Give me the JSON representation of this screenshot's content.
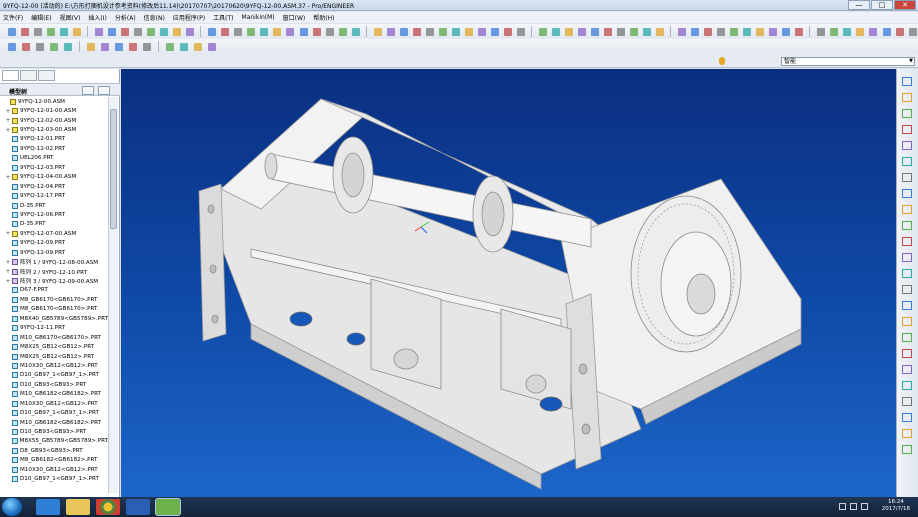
{
  "window": {
    "title": "9YFQ-12-00 (活动的) E:\\方形打捆机设计参考资料(修改后11.14)\\20170707\\20170620\\9YFQ-12-00.ASM.37 - Pro/ENGINEER",
    "controls": [
      "—",
      "□",
      "✕"
    ]
  },
  "menu": [
    "文件(F)",
    "编辑(E)",
    "视图(V)",
    "插入(I)",
    "分析(A)",
    "信息(N)",
    "应用程序(P)",
    "工具(T)",
    "Manikin(M)",
    "窗口(W)",
    "帮助(H)"
  ],
  "filter": {
    "value": "智能"
  },
  "panel": {
    "header": "模型树",
    "tree": [
      {
        "label": "9YFQ-12-00.ASM",
        "kind": "asm",
        "exp": ""
      },
      {
        "label": "9YFQ-12-01-00.ASM",
        "kind": "asm",
        "exp": "+"
      },
      {
        "label": "9YFQ-12-02-00.ASM",
        "kind": "asm",
        "exp": "+"
      },
      {
        "label": "9YFQ-12-03-00.ASM",
        "kind": "asm",
        "exp": "+"
      },
      {
        "label": "9YFQ-12-01.PRT",
        "kind": "prt",
        "exp": ""
      },
      {
        "label": "9YFQ-12-02.PRT",
        "kind": "prt",
        "exp": ""
      },
      {
        "label": "UEL206.PRT",
        "kind": "prt",
        "exp": ""
      },
      {
        "label": "9YFQ-12-03.PRT",
        "kind": "prt",
        "exp": ""
      },
      {
        "label": "9YFQ-12-04-00.ASM",
        "kind": "asm",
        "exp": "+"
      },
      {
        "label": "9YFQ-12-04.PRT",
        "kind": "prt",
        "exp": ""
      },
      {
        "label": "9YFQ-12-17.PRT",
        "kind": "prt",
        "exp": ""
      },
      {
        "label": "D-35.PRT",
        "kind": "prt",
        "exp": ""
      },
      {
        "label": "9YFQ-12-06.PRT",
        "kind": "prt",
        "exp": ""
      },
      {
        "label": "D-35.PRT",
        "kind": "prt",
        "exp": ""
      },
      {
        "label": "9YFQ-12-07-00.ASM",
        "kind": "asm",
        "exp": "+"
      },
      {
        "label": "9YFQ-12-09.PRT",
        "kind": "prt",
        "exp": ""
      },
      {
        "label": "9YFQ-12-09.PRT",
        "kind": "prt",
        "exp": ""
      },
      {
        "label": "阵列 1 / 9YFQ-12-08-00.ASM",
        "kind": "pat",
        "exp": "+"
      },
      {
        "label": "阵列 2 / 9YFQ-12-10.PRT",
        "kind": "pat",
        "exp": "+"
      },
      {
        "label": "阵列 3 / 9YFQ-12-09-00.ASM",
        "kind": "pat",
        "exp": "+"
      },
      {
        "label": "D67-F.PRT",
        "kind": "prt",
        "exp": ""
      },
      {
        "label": "M8_GB6170<GB6170>.PRT",
        "kind": "prt",
        "exp": ""
      },
      {
        "label": "M8_GB6170<GB6170>.PRT",
        "kind": "prt",
        "exp": ""
      },
      {
        "label": "M8X40_GB5789<GB5789>.PRT",
        "kind": "prt",
        "exp": ""
      },
      {
        "label": "9YFQ-12-11.PRT",
        "kind": "prt",
        "exp": ""
      },
      {
        "label": "M10_GB6170<GB6170>.PRT",
        "kind": "prt",
        "exp": ""
      },
      {
        "label": "M8X25_GB12<GB12>.PRT",
        "kind": "prt",
        "exp": ""
      },
      {
        "label": "M8X25_GB12<GB12>.PRT",
        "kind": "prt",
        "exp": ""
      },
      {
        "label": "M10X30_GB12<GB12>.PRT",
        "kind": "prt",
        "exp": ""
      },
      {
        "label": "D10_GB97_1<GB97_1>.PRT",
        "kind": "prt",
        "exp": ""
      },
      {
        "label": "D10_GB93<GB93>.PRT",
        "kind": "prt",
        "exp": ""
      },
      {
        "label": "M10_GB6182<GB6182>.PRT",
        "kind": "prt",
        "exp": ""
      },
      {
        "label": "M10X30_GB12<GB12>.PRT",
        "kind": "prt",
        "exp": ""
      },
      {
        "label": "D10_GB97_1<GB97_1>.PRT",
        "kind": "prt",
        "exp": ""
      },
      {
        "label": "M10_GB6182<GB6182>.PRT",
        "kind": "prt",
        "exp": ""
      },
      {
        "label": "D10_GB93<GB93>.PRT",
        "kind": "prt",
        "exp": ""
      },
      {
        "label": "M8X55_GB5789<GB5789>.PRT",
        "kind": "prt",
        "exp": ""
      },
      {
        "label": "D8_GB93<GB93>.PRT",
        "kind": "prt",
        "exp": ""
      },
      {
        "label": "M8_GB6182<GB6182>.PRT",
        "kind": "prt",
        "exp": ""
      },
      {
        "label": "M10X30_GB12<GB12>.PRT",
        "kind": "prt",
        "exp": ""
      },
      {
        "label": "D10_GB97_1<GB97_1>.PRT",
        "kind": "prt",
        "exp": ""
      }
    ]
  },
  "taskbar": {
    "time": "16:24",
    "date": "2017/7/18",
    "apps": [
      "ie-icon",
      "folder-icon",
      "chrome-icon",
      "word-icon",
      "proe-icon"
    ]
  },
  "colors": {
    "viewport_top": "#0a2f80",
    "viewport_bottom": "#1d66c9",
    "model": "#eeeeee"
  }
}
